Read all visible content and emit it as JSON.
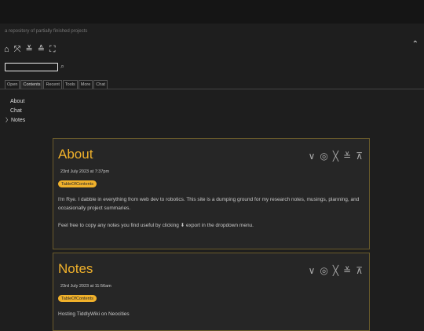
{
  "sidebar": {
    "subtitle": "a repository of partially finished projects",
    "toolbar_icons": [
      "home-icon",
      "close-all-icon",
      "fold-icon",
      "unfold-icon",
      "fullscreen-icon"
    ],
    "search": {
      "value": "",
      "placeholder": ""
    },
    "tabs": [
      {
        "label": "Open"
      },
      {
        "label": "Contents",
        "active": true
      },
      {
        "label": "Recent"
      },
      {
        "label": "Tools"
      },
      {
        "label": "More"
      },
      {
        "label": "Chat"
      }
    ],
    "toc": [
      {
        "label": "About"
      },
      {
        "label": "Chat"
      },
      {
        "label": "Notes",
        "prefix": "〉"
      }
    ]
  },
  "story": [
    {
      "title": "About",
      "date": "23rd July 2023 at 7:37pm",
      "tag": "TableOfContents",
      "body": [
        "I'm Rye. I dabble in everything from web dev to robotics. This site is a dumping ground for my research notes, musings, planning, and occasionally project summaries.",
        "Feel free to copy any notes you find useful by clicking ⬇ export in the dropdown menu."
      ]
    },
    {
      "title": "Notes",
      "date": "23rd July 2023 at 11:56am",
      "tag": "TableOfContents",
      "body": [
        "Hosting TiddlyWiki on Neocities"
      ]
    }
  ],
  "colors": {
    "accent": "#f0b12b",
    "border": "#6a5b2b",
    "panel": "#262626",
    "background": "#1e1e1e"
  }
}
